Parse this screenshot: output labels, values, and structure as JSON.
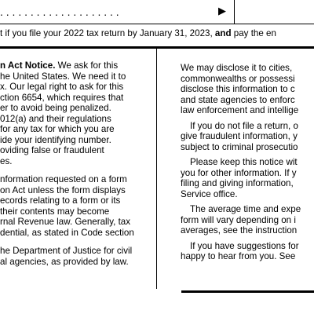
{
  "top": {
    "leader_dots": ". . . . . . . . . . . . . . . . . . . .",
    "arrow_glyph": "▶",
    "note_prefix": "t if you file your 2022 tax return by January 31, 2023,",
    "note_bold": "and",
    "note_suffix": "pay the en"
  },
  "left_column": {
    "heading_bold": "n Act Notice.",
    "heading_rest": "We ask for this",
    "lines": [
      "he United States. We need it to",
      "x. Our legal right to ask for this",
      "ction 6654, which requires that",
      "er to avoid being penalized.",
      "012(a) and their regulations",
      " for any tax for which you are",
      "ide your identifying number.",
      "oviding false or fraudulent",
      "es."
    ],
    "para2_lines": [
      "nformation requested on a form",
      "on Act unless the form displays",
      "ecords relating to a form or its",
      " their contents may become",
      "rnal Revenue law. Generally, tax",
      "dential, as stated in Code section"
    ],
    "para3_lines": [
      "he Department of Justice for civil",
      "al agencies, as provided by law."
    ]
  },
  "right_column": {
    "para1_lines": [
      "We may disclose it to cities,",
      "commonwealths or possessi",
      "disclose this information to c",
      "and state agencies to enforc",
      "law enforcement and intellige"
    ],
    "para2_lines": [
      "If you do not file a return, o",
      "give fraudulent information, y",
      "subject to criminal prosecutio"
    ],
    "para3_lines": [
      "Please keep this notice wit",
      "you for other information. If y",
      "filing and giving information,",
      "Service office."
    ],
    "para4_lines": [
      "The average time and expe",
      "form will vary depending on i",
      "averages, see the instruction"
    ],
    "para5_lines": [
      "If you have suggestions for",
      "happy to hear from you. See"
    ]
  }
}
